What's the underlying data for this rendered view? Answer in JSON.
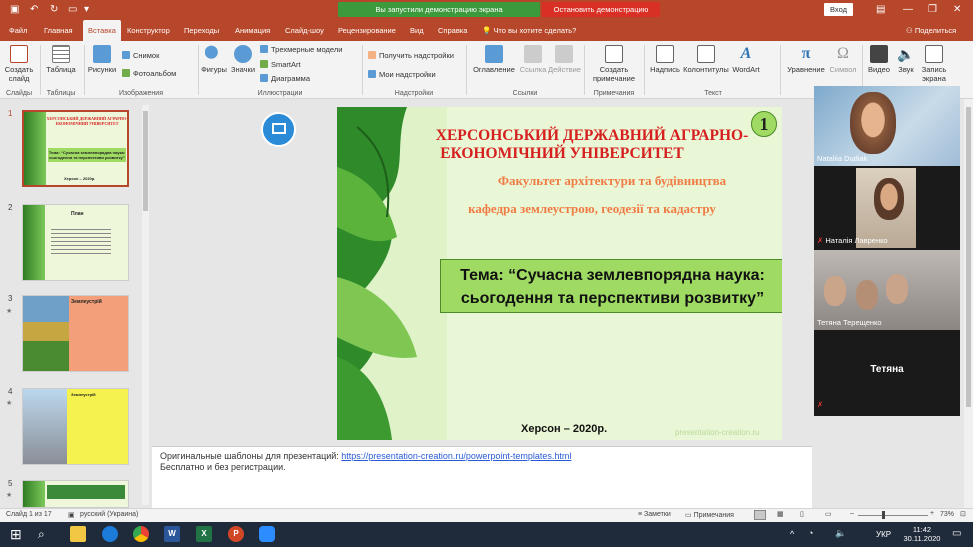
{
  "titlebar": {
    "share_banner": "Вы запустили демонстрацию экрана",
    "stop_button": "Остановить демонстрацию",
    "login_button": "Вход"
  },
  "tabs": [
    "Файл",
    "Главная",
    "Вставка",
    "Конструктор",
    "Переходы",
    "Анимация",
    "Слайд-шоу",
    "Рецензирование",
    "Вид",
    "Справка"
  ],
  "tell_me": "Что вы хотите сделать?",
  "share_label": "Поделиться",
  "ribbon": {
    "create_slide": "Создать слайд",
    "table": "Таблица",
    "pictures": "Рисунки",
    "snapshot": "Снимок",
    "photo_album": "Фотоальбом",
    "shapes": "Фигуры",
    "icons": "Значки",
    "models3d": "Трехмерные модели",
    "smartart": "SmartArt",
    "diagram": "Диаграмма",
    "get_addins": "Получить надстройки",
    "my_addins": "Мои надстройки",
    "zoom_link": "Оглавление",
    "link": "Ссылка",
    "action": "Действие",
    "new_comment": "Создать примечание",
    "textbox": "Надпись",
    "header_footer": "Колонтитулы",
    "wordart": "WordArt",
    "equation": "Уравнение",
    "symbol": "Символ",
    "video": "Видео",
    "audio": "Звук",
    "screen_record": "Запись экрана",
    "groups": {
      "slides": "Слайды",
      "tables": "Таблицы",
      "images": "Изображения",
      "illustrations": "Иллюстрации",
      "addins": "Надстройки",
      "links": "Ссылки",
      "comments": "Примечания",
      "text": "Текст"
    }
  },
  "thumbnails": [
    {
      "num": "1",
      "title": "ХЕРСОНСЬКИЙ ДЕРЖАВНИЙ АГРАРНО-ЕКОНОМІЧНИЙ УНІВЕРСИТЕТ",
      "topic": "Тема: “Сучасна землевпорядна наука: сьогодення та перспективи розвитку”",
      "footer": "Херсон – 2020р."
    },
    {
      "num": "2",
      "title": "План"
    },
    {
      "num": "3",
      "title": "Землеустрій"
    },
    {
      "num": "4",
      "title": "Землеустрій"
    },
    {
      "num": "5",
      "title": ""
    }
  ],
  "slide": {
    "number": "1",
    "uni_line1": "ХЕРСОНСЬКИЙ ДЕРЖАВНИЙ АГРАРНО-",
    "uni_line2": "ЕКОНОМІЧНИЙ УНІВЕРСИТЕТ",
    "faculty": "Факультет архітектури та будівництва",
    "department": "кафедра землеустрою, геодезії та кадастру",
    "topic_line1": "Тема: “Сучасна землевпорядна наука:",
    "topic_line2": "сьогодення та перспективи розвитку”",
    "footer": "Херсон – 2020р.",
    "watermark": "presentation-creation.ru"
  },
  "notes": {
    "line1": "Оригинальные шаблоны для презентаций: ",
    "link": "https://presentation-creation.ru/powerpoint-templates.html",
    "line2": "Бесплатно и без регистрации."
  },
  "participants": [
    {
      "name": "Nataliia Dudiak"
    },
    {
      "name": "Наталія Лавренко"
    },
    {
      "name": "Тетяна Терещенко"
    },
    {
      "name": "Тетяна"
    }
  ],
  "status": {
    "slide_of": "Слайд 1 из 17",
    "language": "русский (Украина)",
    "notes": "Заметки",
    "comments": "Примечания",
    "zoom": "73%"
  },
  "taskbar": {
    "time": "11:42",
    "date": "30.11.2020",
    "lang": "УКР"
  },
  "colors": {
    "accent": "#b7472a",
    "green": "#9fdb63"
  }
}
